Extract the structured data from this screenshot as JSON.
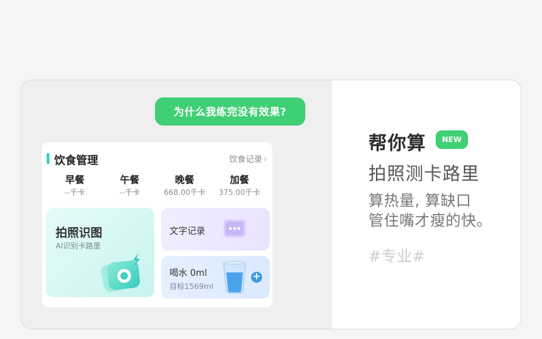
{
  "chat": {
    "question": "为什么我练完没有效果?"
  },
  "diet_card": {
    "title": "饮食管理",
    "record_link": "饮食记录",
    "meals": [
      {
        "name": "早餐",
        "kcal": "--千卡"
      },
      {
        "name": "午餐",
        "kcal": "--千卡"
      },
      {
        "name": "晚餐",
        "kcal": "668.00千卡"
      },
      {
        "name": "加餐",
        "kcal": "375.00千卡"
      }
    ],
    "photo_tile": {
      "title": "拍照识图",
      "subtitle": "AI识别卡路里"
    },
    "text_tile": {
      "title": "文字记录"
    },
    "water_tile": {
      "title": "喝水 0ml",
      "subtitle": "目标1569ml",
      "add": "+"
    }
  },
  "feature": {
    "title": "帮你算",
    "badge": "NEW",
    "subtitle": "拍照测卡路里",
    "desc_line1": "算热量, 算缺口",
    "desc_line2": "管住嘴才瘦的快。",
    "tag": "#专业#"
  },
  "colors": {
    "green": "#3fcf74",
    "teal": "#2ed0c4",
    "blue": "#3b9bdb"
  },
  "icons": [
    "camera-icon",
    "lightning-icon",
    "note-icon",
    "water-cup-icon",
    "plus-icon",
    "chevron-right-icon"
  ]
}
